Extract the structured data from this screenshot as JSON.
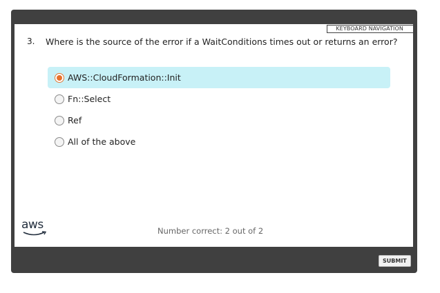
{
  "header": {
    "keyboard_nav_label": "KEYBOARD NAVIGATION"
  },
  "question": {
    "number": "3.",
    "text": "Where is the source of the error if a WaitConditions times out or returns an error?"
  },
  "options": [
    {
      "label": "AWS::CloudFormation::Init",
      "selected": true
    },
    {
      "label": "Fn::Select",
      "selected": false
    },
    {
      "label": "Ref",
      "selected": false
    },
    {
      "label": "All of the above",
      "selected": false
    }
  ],
  "footer": {
    "logo_text": "aws",
    "score_text": "Number correct: 2 out of 2",
    "submit_label": "SUBMIT"
  },
  "colors": {
    "frame": "#404040",
    "selected_bg": "#c8f1f7",
    "radio_checked": "#e8702a"
  }
}
